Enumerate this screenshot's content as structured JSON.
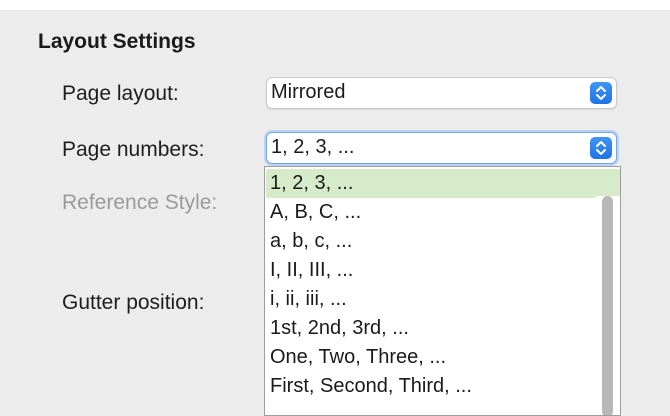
{
  "section": {
    "title": "Layout Settings"
  },
  "fields": {
    "page_layout": {
      "label": "Page layout:",
      "value": "Mirrored"
    },
    "page_numbers": {
      "label": "Page numbers:",
      "value": "1, 2, 3, ..."
    },
    "reference_style": {
      "label": "Reference Style:"
    },
    "gutter_position": {
      "label": "Gutter position:"
    }
  },
  "dropdown": {
    "options": [
      "1, 2, 3, ...",
      "A, B, C, ...",
      "a, b, c, ...",
      "I, II, III, ...",
      "i, ii, iii, ...",
      "1st, 2nd, 3rd, ...",
      "One, Two, Three, ...",
      "First, Second, Third, ..."
    ],
    "selected_index": 0
  },
  "colors": {
    "selected_option_bg": "#d6ebc9",
    "stepper_blue": "#2a80ee",
    "disabled_text": "#9a9a9a"
  },
  "icons": {
    "stepper": "chevron-up-down-icon"
  }
}
